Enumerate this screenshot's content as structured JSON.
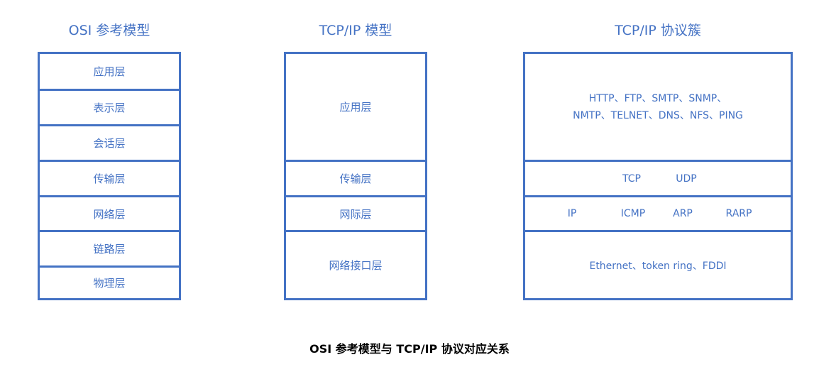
{
  "osi": {
    "title": "OSI 参考模型",
    "layers": [
      "应用层",
      "表示层",
      "会话层",
      "传输层",
      "网络层",
      "链路层",
      "物理层"
    ]
  },
  "tcpip": {
    "title": "TCP/IP 模型",
    "layers": [
      "应用层",
      "传输层",
      "网际层",
      "网络接口层"
    ]
  },
  "suite": {
    "title": "TCP/IP 协议簇",
    "application_line1": "HTTP、FTP、SMTP、SNMP、",
    "application_line2": "NMTP、TELNET、DNS、NFS、PING",
    "transport": [
      "TCP",
      "UDP"
    ],
    "internet": [
      "IP",
      "ICMP",
      "ARP",
      "RARP"
    ],
    "link": "Ethernet、token ring、FDDI"
  },
  "caption": "OSI 参考模型与 TCP/IP 协议对应关系",
  "colors": {
    "accent": "#4472c4",
    "caption": "#000000"
  }
}
